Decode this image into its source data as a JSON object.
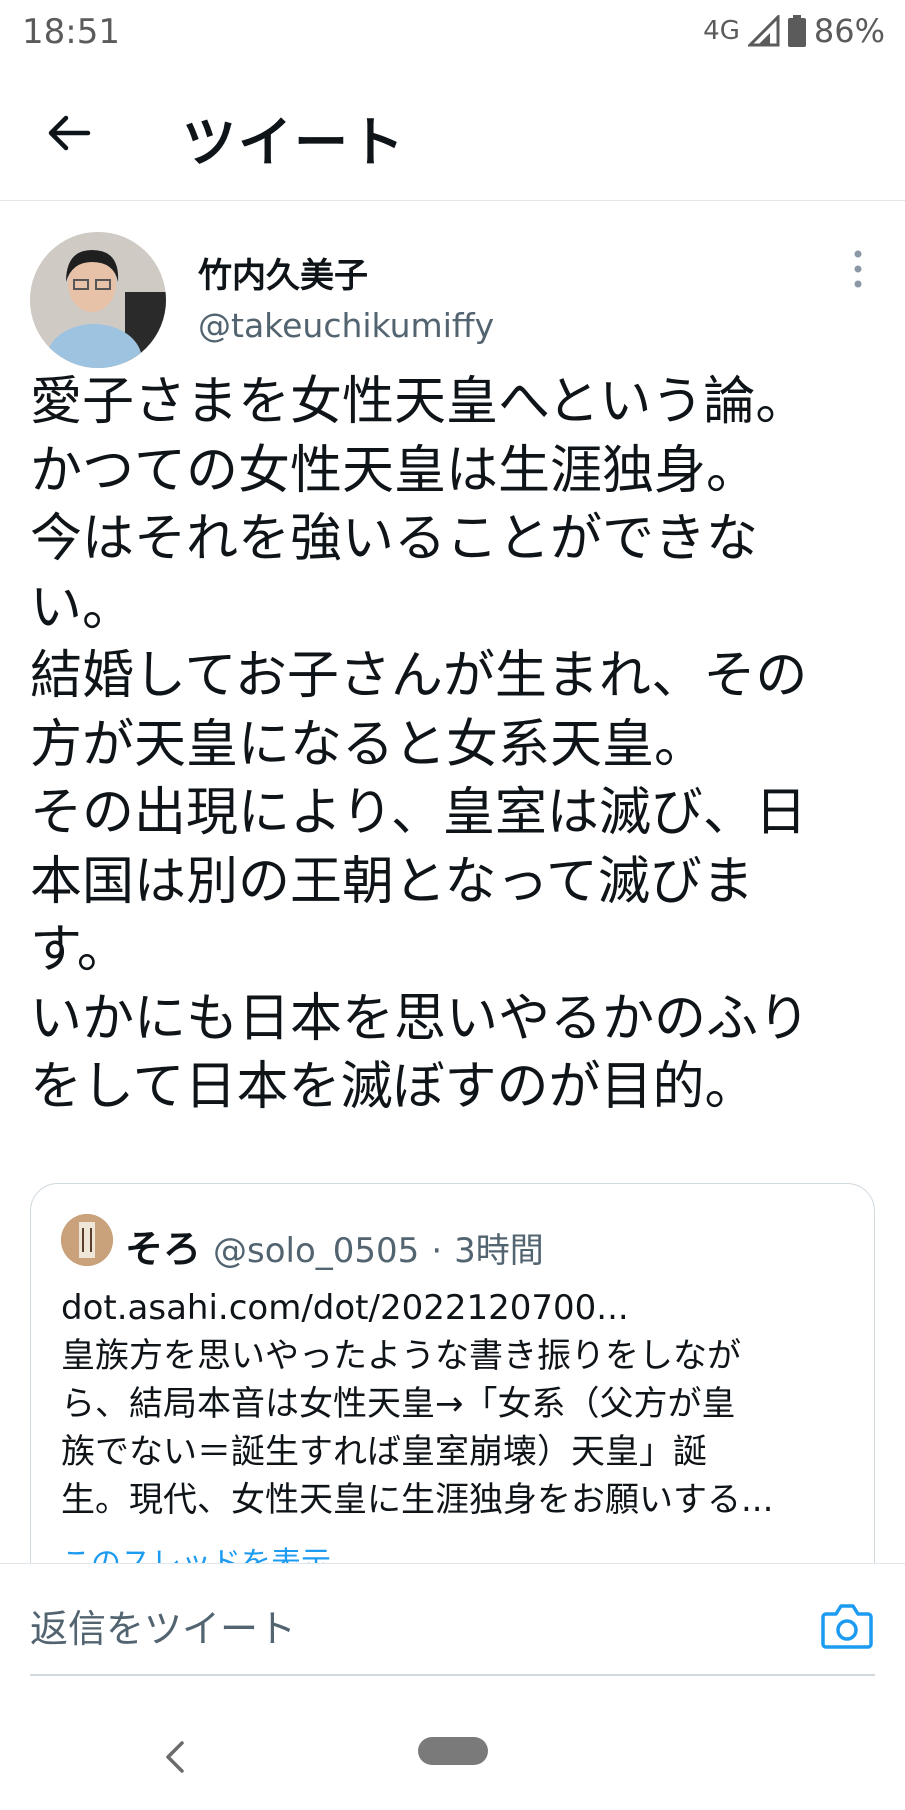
{
  "status_bar": {
    "time": "18:51",
    "network": "4G",
    "battery_percent": "86%"
  },
  "header": {
    "title": "ツイート"
  },
  "tweet": {
    "author_name": "竹内久美子",
    "author_handle": "@takeuchikumiffy",
    "lines": [
      "愛子さまを女性天皇へという論。",
      "かつての女性天皇は生涯独身。",
      "今はそれを強いることができな",
      "い。",
      "結婚してお子さんが生まれ、その",
      "方が天皇になると女系天皇。",
      "その出現により、皇室は滅び、日",
      "本国は別の王朝となって滅びま",
      "す。",
      "いかにも日本を思いやるかのふり",
      "をして日本を滅ぼすのが目的。"
    ]
  },
  "quote": {
    "author_name": "そろ",
    "author_handle": "@solo_0505",
    "separator": "·",
    "time": "3時間",
    "lines": [
      "dot.asahi.com/dot/2022120700...",
      "皇族方を思いやったような書き振りをしなが",
      "ら、結局本音は女性天皇→「女系（父方が皇",
      "族でない＝誕生すれば皇室崩壊）天皇」誕",
      "生。現代、女性天皇に生涯独身をお願いする..."
    ],
    "show_thread": "このスレッドを表示"
  },
  "reply": {
    "placeholder": "返信をツイート"
  },
  "colors": {
    "accent": "#1d9bf0",
    "secondary_text": "#536471",
    "text": "#0f1419"
  },
  "icons": [
    "back-arrow-icon",
    "more-vertical-icon",
    "camera-icon",
    "signal-icon",
    "battery-icon",
    "nav-back-icon"
  ]
}
